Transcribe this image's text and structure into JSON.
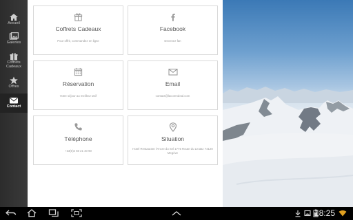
{
  "sidebar": {
    "items": [
      {
        "label": "Accueil",
        "icon": "home-icon"
      },
      {
        "label": "Galeries",
        "icon": "gallery-icon"
      },
      {
        "label": "Coffrets Cadeaux",
        "icon": "gift-icon"
      },
      {
        "label": "Offres",
        "icon": "star-icon"
      },
      {
        "label": "Contact",
        "icon": "mail-icon",
        "active": true
      }
    ]
  },
  "cards": [
    {
      "title": "Coffrets Cadeaux",
      "subtitle": "Pour offrir, commandez en ligne",
      "icon": "gift-icon"
    },
    {
      "title": "Facebook",
      "subtitle": "Devenez fan",
      "icon": "facebook-icon"
    },
    {
      "title": "Réservation",
      "subtitle": "Votre séjour au meilleur tarif",
      "icon": "calendar-icon"
    },
    {
      "title": "Email",
      "subtitle": "contact@lacorendeal.com",
      "icon": "envelope-icon"
    },
    {
      "title": "Téléphone",
      "subtitle": "+33(0)4 50 21 40 90",
      "icon": "phone-icon"
    },
    {
      "title": "Situation",
      "subtitle": "Hotel Restaurant l'Ancre du Sel 1775 Route du Leutaz 74120 Megève",
      "icon": "map-pin-icon"
    }
  ],
  "system_bar": {
    "clock": "18:25"
  }
}
